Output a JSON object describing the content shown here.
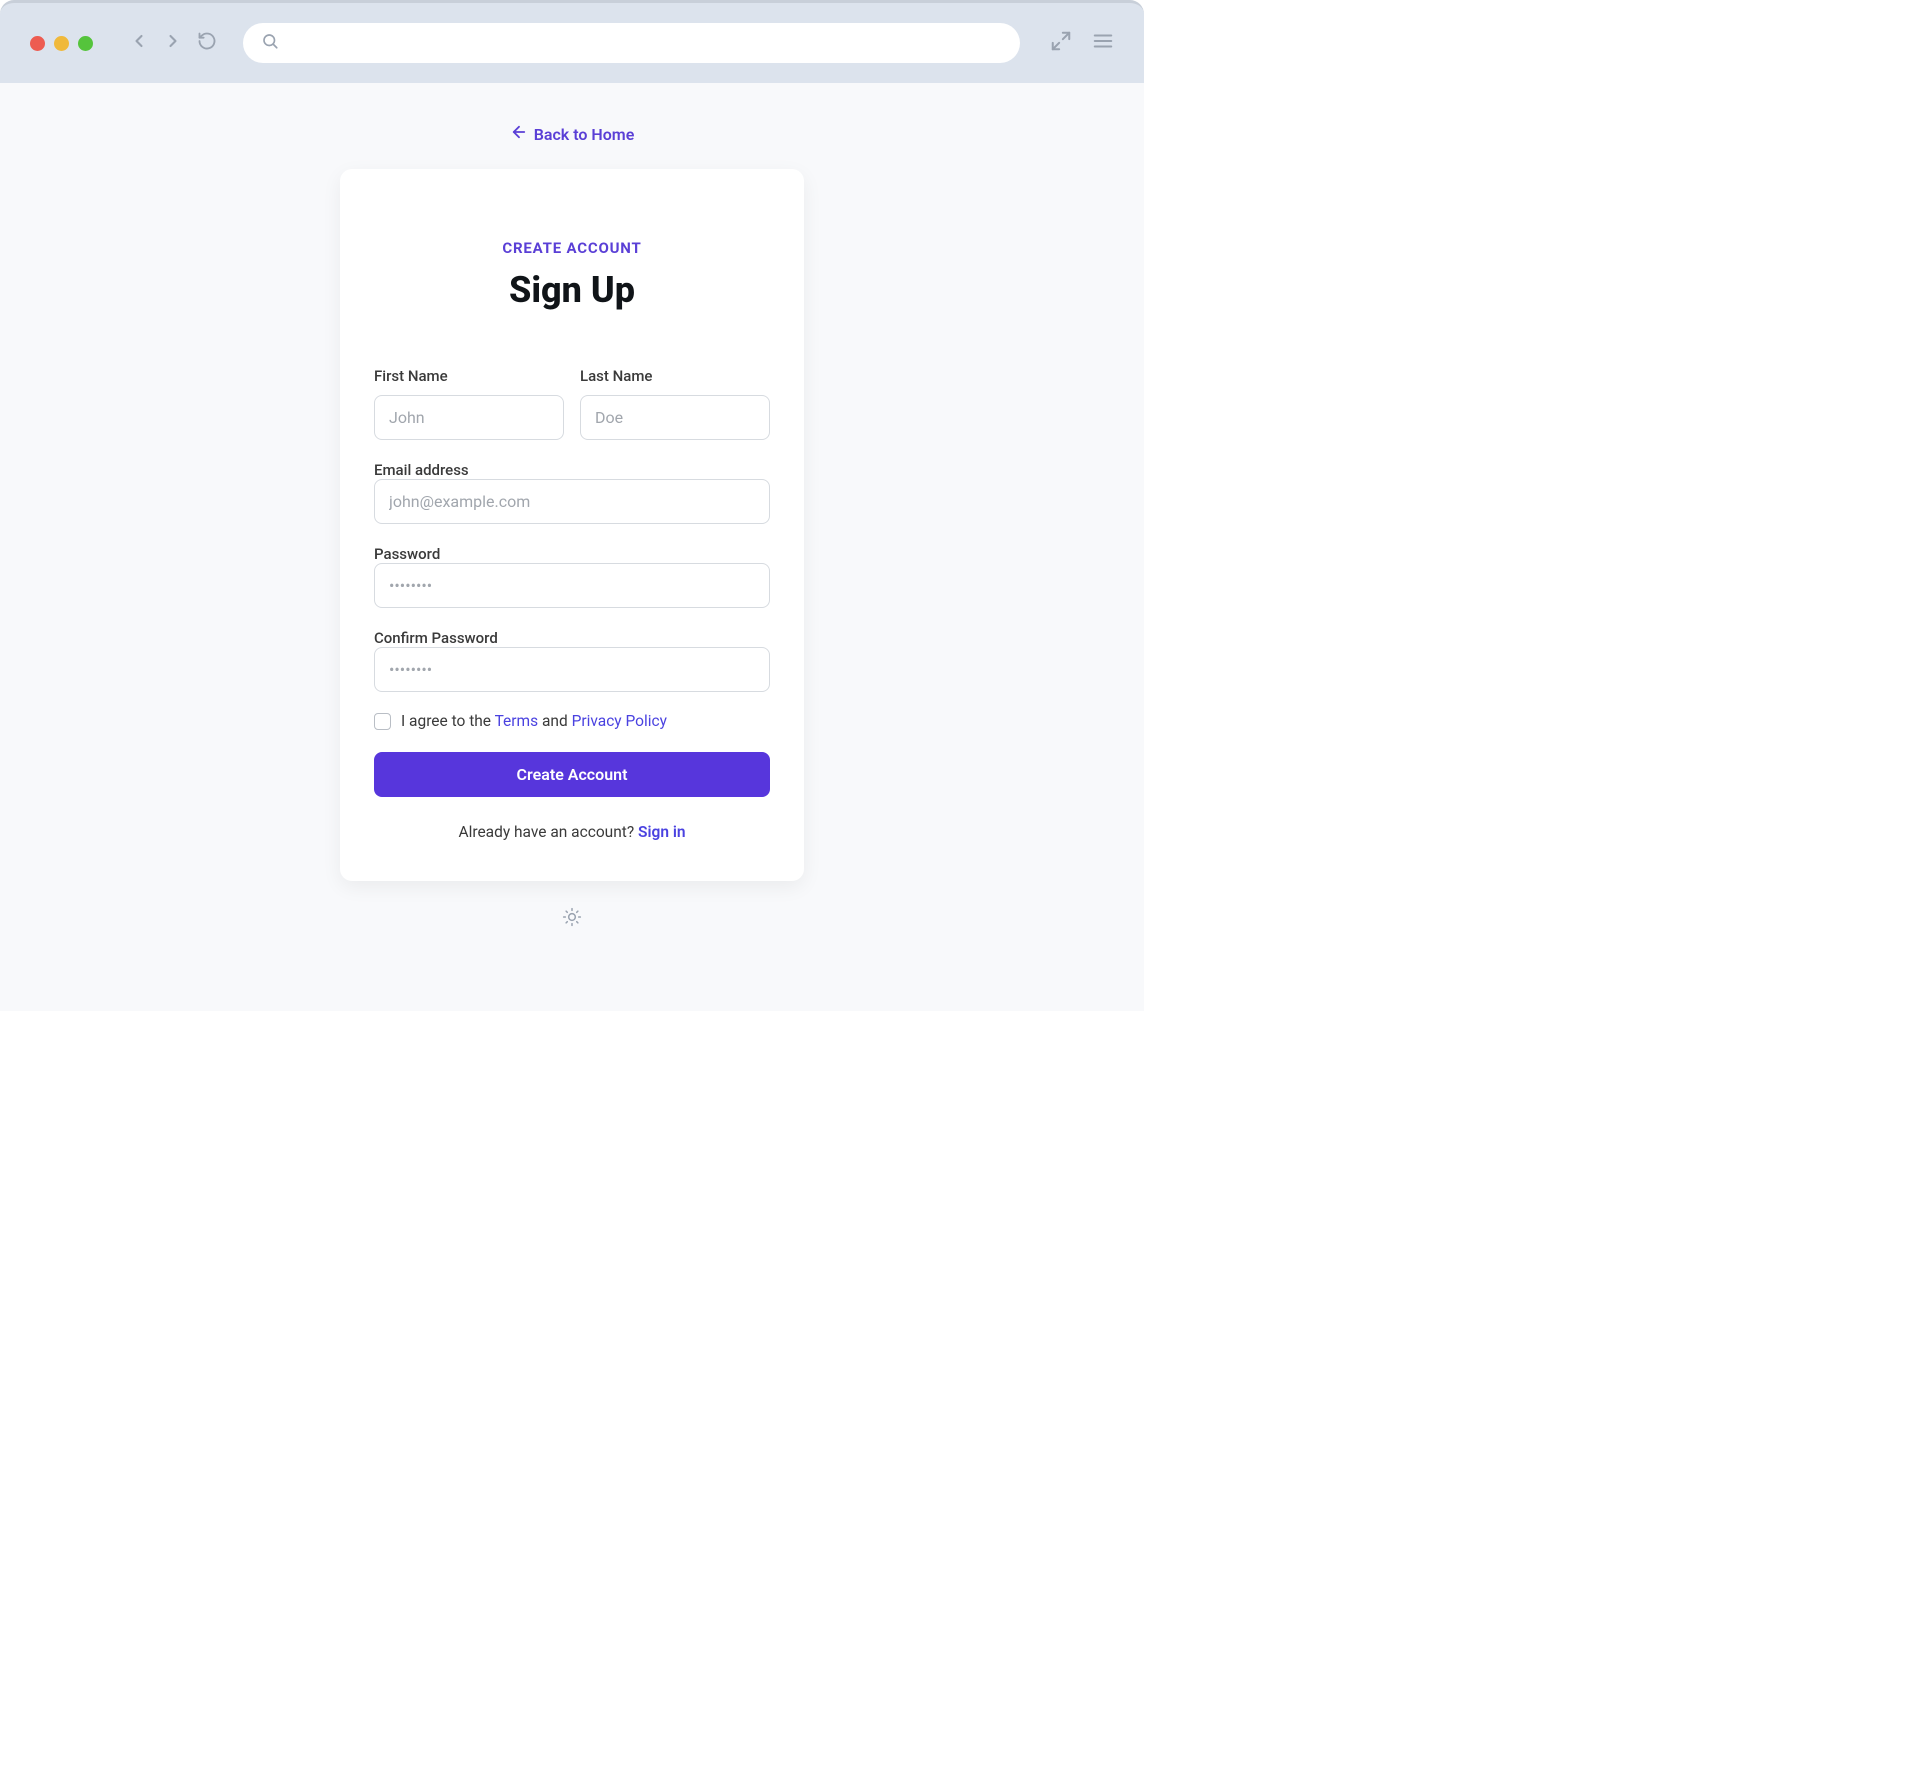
{
  "nav": {
    "back_to_home": "Back to Home"
  },
  "card": {
    "subtitle": "CREATE ACCOUNT",
    "title": "Sign Up"
  },
  "form": {
    "first_name": {
      "label": "First Name",
      "placeholder": "John",
      "value": ""
    },
    "last_name": {
      "label": "Last Name",
      "placeholder": "Doe",
      "value": ""
    },
    "email": {
      "label": "Email address",
      "placeholder": "john@example.com",
      "value": ""
    },
    "password": {
      "label": "Password",
      "placeholder": "••••••••",
      "value": ""
    },
    "confirm_password": {
      "label": "Confirm Password",
      "placeholder": "••••••••",
      "value": ""
    },
    "agree": {
      "prefix": "I agree to the ",
      "terms": "Terms",
      "and": " and ",
      "privacy": "Privacy Policy"
    },
    "submit": "Create Account",
    "signin_prompt": "Already have an account? ",
    "signin_link": "Sign in"
  },
  "colors": {
    "accent": "#5736dc",
    "link": "#4a42e0"
  }
}
